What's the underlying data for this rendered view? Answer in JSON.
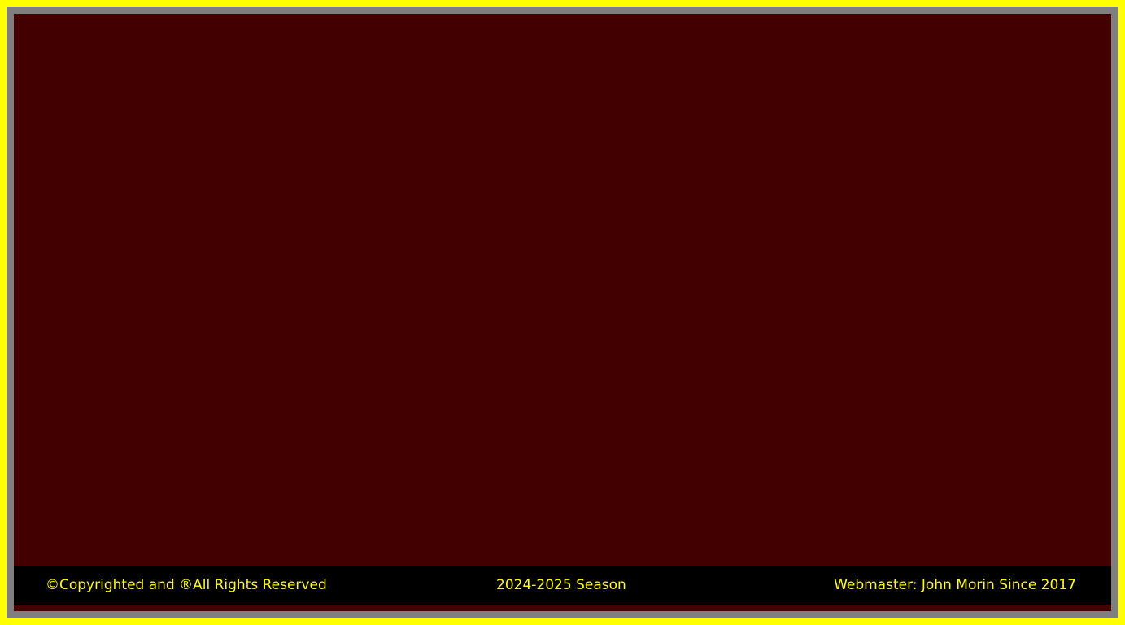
{
  "footer": {
    "copyright": "©Copyrighted and ®All Rights Reserved",
    "season": "2024-2025 Season",
    "webmaster": "Webmaster: John Morin Since 2017"
  },
  "colors": {
    "border": "#ffff00",
    "frame": "#7f7f7f",
    "panel": "#420000",
    "footer_background": "#000000",
    "footer_text": "#ffff00"
  }
}
